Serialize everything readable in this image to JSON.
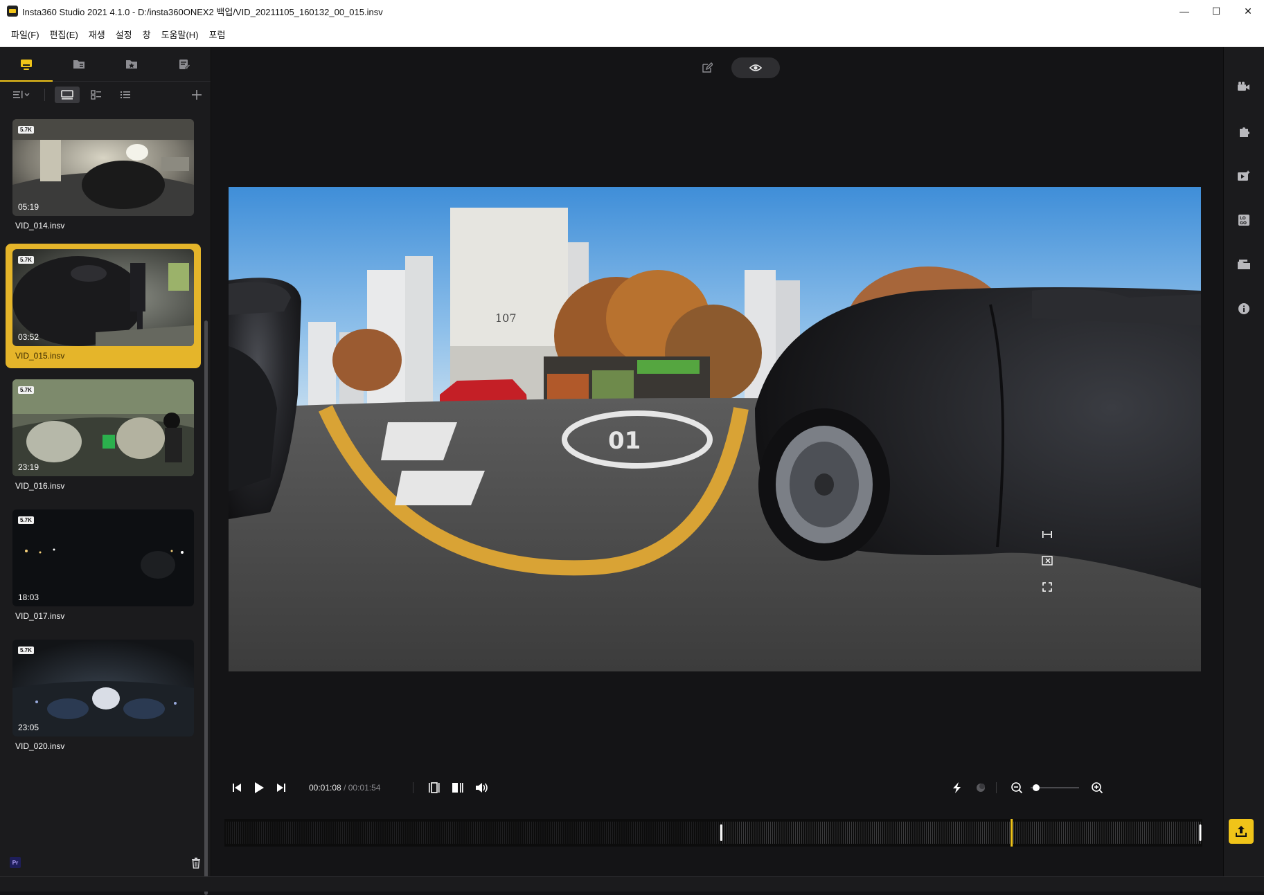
{
  "window": {
    "title": "Insta360 Studio 2021 4.1.0 - D:/insta360ONEX2 백업/VID_20211105_160132_00_015.insv",
    "minimize": "—",
    "maximize": "☐",
    "close": "✕"
  },
  "menu": [
    "파일(F)",
    "편집(E)",
    "재생",
    "설정",
    "창",
    "도움말(H)",
    "포럼"
  ],
  "sidebar": {
    "tabs": [
      "media-icon",
      "folder-icon",
      "star-icon",
      "edit-list-icon"
    ],
    "items": [
      {
        "name": "VID_014.insv",
        "duration": "05:19",
        "badge": "5.7K",
        "selected": false,
        "theme": "garage"
      },
      {
        "name": "VID_015.insv",
        "duration": "03:52",
        "badge": "5.7K",
        "selected": true,
        "theme": "car"
      },
      {
        "name": "VID_016.insv",
        "duration": "23:19",
        "badge": "5.7K",
        "selected": false,
        "theme": "interior"
      },
      {
        "name": "VID_017.insv",
        "duration": "18:03",
        "badge": "5.7K",
        "selected": false,
        "theme": "night"
      },
      {
        "name": "VID_020.insv",
        "duration": "23:05",
        "badge": "5.7K",
        "selected": false,
        "theme": "night-interior"
      }
    ],
    "pr_badge": "Pr"
  },
  "player": {
    "current_time": "00:01:08",
    "total_time": "/ 00:01:54",
    "building_label": "107",
    "road_number": "01",
    "zoom_level": 0.05,
    "playhead_position": 0.805,
    "trim_in": 0.508,
    "trim_out": 0.999
  },
  "colors": {
    "accent": "#f0c419",
    "panel": "#1b1b1d",
    "background": "#141416"
  }
}
